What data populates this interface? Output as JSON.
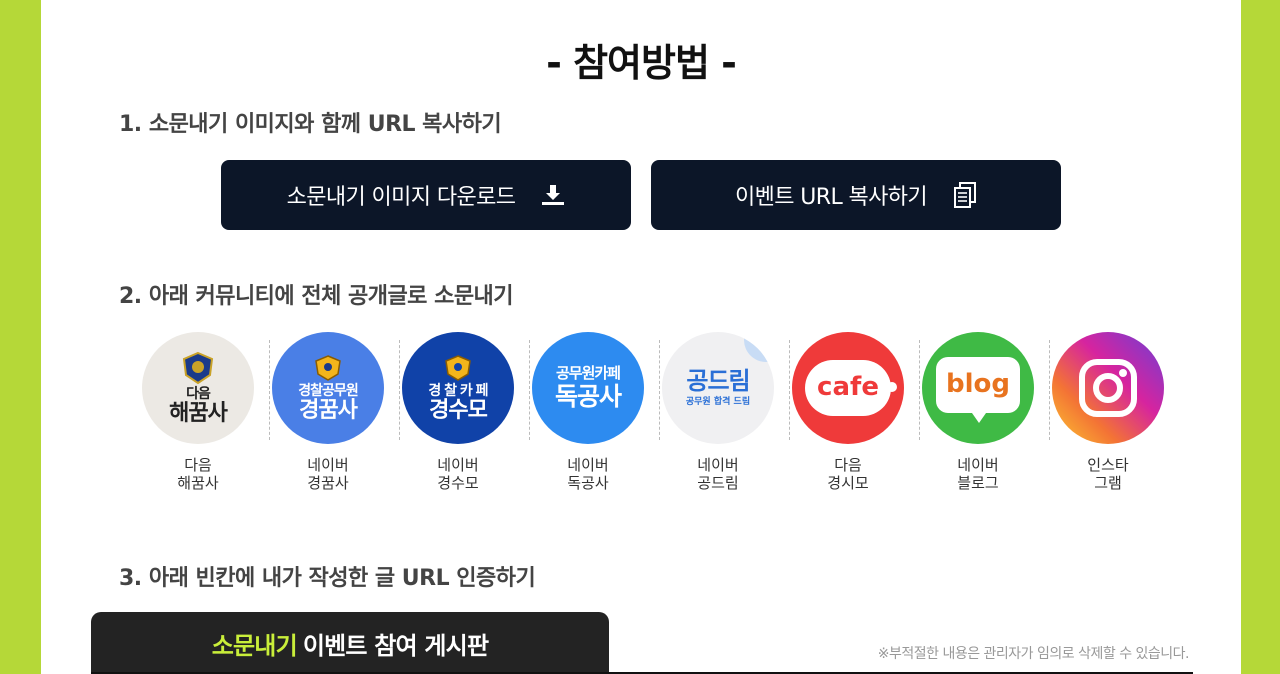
{
  "header": {
    "title": "- 참여방법 -"
  },
  "steps": {
    "step1": "1. 소문내기 이미지와 함께 URL 복사하기",
    "step2": "2. 아래 커뮤니티에 전체 공개글로 소문내기",
    "step3": "3. 아래 빈칸에 내가 작성한 글 URL 인증하기"
  },
  "buttons": {
    "download_label": "소문내기 이미지 다운로드",
    "download_icon": "download-icon",
    "copy_label": "이벤트 URL 복사하기",
    "copy_icon": "copy-icon"
  },
  "communities": [
    {
      "line1": "다음",
      "line2": "해꿈사",
      "logo_lines": [
        "다음",
        "해꿈사"
      ],
      "bg": "#ece9e4",
      "fg": "#222222"
    },
    {
      "line1": "네이버",
      "line2": "경꿈사",
      "logo_lines": [
        "경찰공무원",
        "경꿈사"
      ],
      "bg": "#4a7fe6",
      "fg": "#ffffff"
    },
    {
      "line1": "네이버",
      "line2": "경수모",
      "logo_lines": [
        "경 찰 카 페",
        "경수모"
      ],
      "bg": "#1042a8",
      "fg": "#ffffff"
    },
    {
      "line1": "네이버",
      "line2": "독공사",
      "logo_lines": [
        "공무원카페",
        "독공사"
      ],
      "bg": "#2d8bf0",
      "fg": "#ffffff"
    },
    {
      "line1": "네이버",
      "line2": "공드림",
      "logo_lines": [
        "공드림",
        "공무원 합격 드림"
      ],
      "bg": "#f0f0f2",
      "fg": "#2a6fd6"
    },
    {
      "line1": "다음",
      "line2": "경시모",
      "logo_lines": [
        "cafe"
      ],
      "bg": "#ef3a3a",
      "fg": "#ef3a3a"
    },
    {
      "line1": "네이버",
      "line2": "블로그",
      "logo_lines": [
        "blog"
      ],
      "bg": "#3fba45",
      "fg": "#e8731f"
    },
    {
      "line1": "인스타",
      "line2": "그램",
      "logo_lines": [],
      "bg": "#d6249f",
      "fg": "#ffffff"
    }
  ],
  "board": {
    "highlight": "소문내기",
    "rest": "이벤트 참여 게시판",
    "notice": "※부적절한 내용은 관리자가 임의로 삭제할 수 있습니다."
  },
  "colors": {
    "page_bg": "#b5d838",
    "button_bg": "#0c1628",
    "highlight": "#c9ee3a"
  }
}
